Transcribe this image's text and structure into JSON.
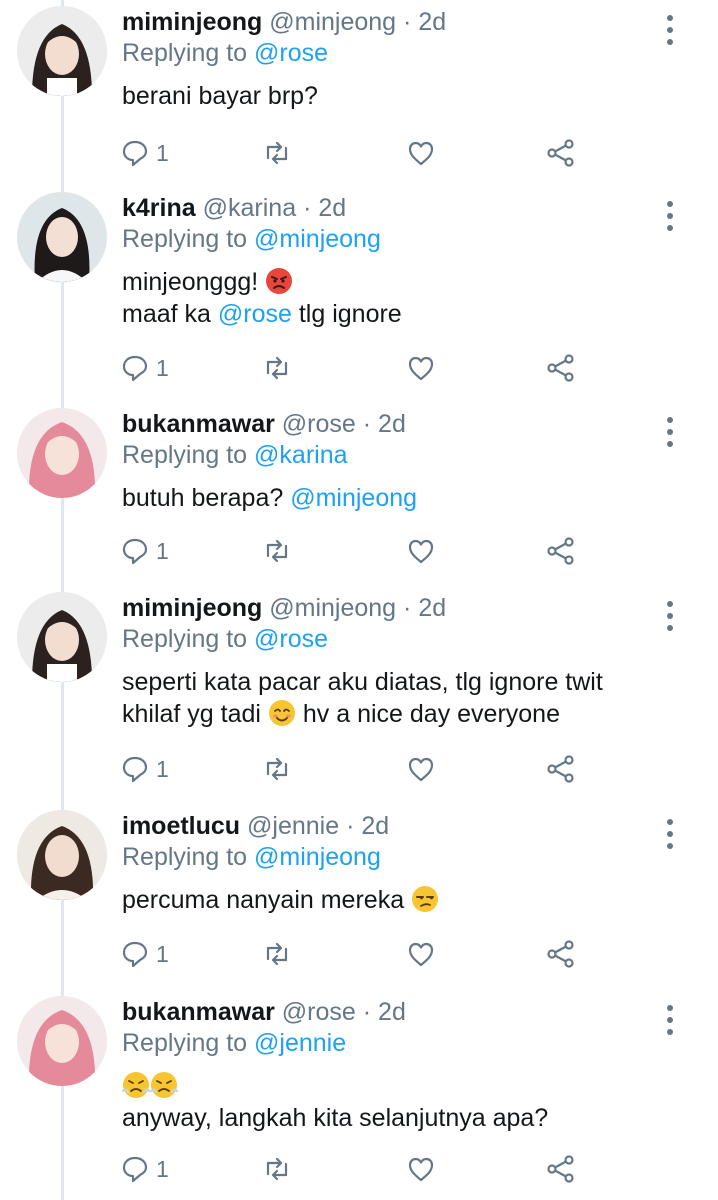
{
  "colors": {
    "accent": "#1da1f2",
    "muted": "#657786",
    "text": "#14171a",
    "thread": "#e1e8ed"
  },
  "tweets": [
    {
      "name": "miminjeong",
      "handle": "@minjeong",
      "dot": "·",
      "time": "2d",
      "replying_prefix": "Replying to",
      "replying_to": "@rose",
      "lines": [
        [
          "berani bayar brp?"
        ]
      ],
      "reply_count": "1",
      "avatar": "avatar-dark-hair"
    },
    {
      "name": "k4rina",
      "handle": "@karina",
      "dot": "·",
      "time": "2d",
      "replying_prefix": "Replying to",
      "replying_to": "@minjeong",
      "line1": "minjeonggg!",
      "emoji1": "angry-face-emoji",
      "line2_pre": "maaf ka",
      "line2_mention": "@rose",
      "line2_post": "tlg ignore",
      "reply_count": "1",
      "avatar": "avatar-long-dark-hair"
    },
    {
      "name": "bukanmawar",
      "handle": "@rose",
      "dot": "·",
      "time": "2d",
      "replying_prefix": "Replying to",
      "replying_to": "@karina",
      "line1_pre": "butuh berapa?",
      "line1_mention": "@minjeong",
      "reply_count": "1",
      "avatar": "avatar-pink-hair"
    },
    {
      "name": "miminjeong",
      "handle": "@minjeong",
      "dot": "·",
      "time": "2d",
      "replying_prefix": "Replying to",
      "replying_to": "@rose",
      "line1": "seperti kata pacar aku diatas, tlg ignore twit",
      "line2_pre": "khilaf yg tadi",
      "emoji1": "smiling-blush-emoji",
      "line2_post": "hv a nice day everyone",
      "reply_count": "1",
      "avatar": "avatar-dark-hair"
    },
    {
      "name": "imoetlucu",
      "handle": "@jennie",
      "dot": "·",
      "time": "2d",
      "replying_prefix": "Replying to",
      "replying_to": "@minjeong",
      "line1": "percuma nanyain mereka",
      "emoji1": "unamused-face-emoji",
      "reply_count": "1",
      "avatar": "avatar-brown-hair"
    },
    {
      "name": "bukanmawar",
      "handle": "@rose",
      "dot": "·",
      "time": "2d",
      "replying_prefix": "Replying to",
      "replying_to": "@jennie",
      "emoji1": "triumph-face-emoji",
      "emoji2": "triumph-face-emoji",
      "line2": "anyway, langkah kita selanjutnya apa?",
      "reply_count": "1",
      "avatar": "avatar-pink-hair"
    }
  ]
}
